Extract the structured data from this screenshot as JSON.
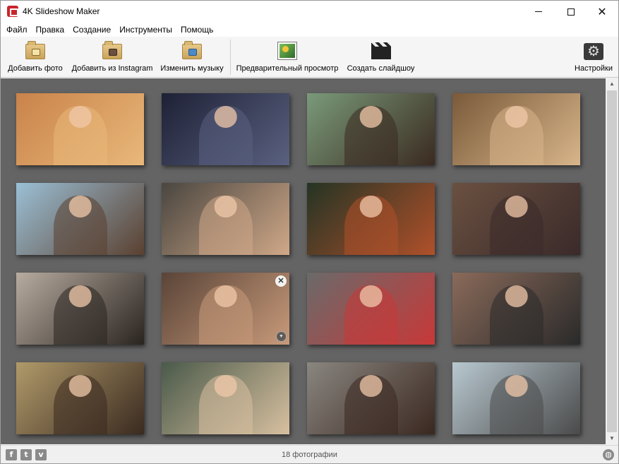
{
  "window": {
    "title": "4K Slideshow Maker"
  },
  "menu": [
    "Файл",
    "Правка",
    "Создание",
    "Инструменты",
    "Помощь"
  ],
  "toolbar": {
    "add_photo": "Добавить фото",
    "add_instagram": "Добавить из Instagram",
    "change_music": "Изменить музыку",
    "preview": "Предварительный просмотр",
    "create_slideshow": "Создать слайдшоу",
    "settings": "Настройки"
  },
  "photos": [
    {
      "bg": "#c9834a",
      "accent": "#e9b87a"
    },
    {
      "bg": "#1e2135",
      "accent": "#5a6080"
    },
    {
      "bg": "#7a9a7a",
      "accent": "#3a2a20"
    },
    {
      "bg": "#7a5a3a",
      "accent": "#d8b58a"
    },
    {
      "bg": "#9bc0d6",
      "accent": "#5a4030"
    },
    {
      "bg": "#4a4640",
      "accent": "#d0a888"
    },
    {
      "bg": "#243424",
      "accent": "#b0502a"
    },
    {
      "bg": "#6a5040",
      "accent": "#3a2a2a"
    },
    {
      "bg": "#b8aca0",
      "accent": "#2a2420"
    },
    {
      "bg": "#5a4438",
      "accent": "#c89a7a"
    },
    {
      "bg": "#6a6a6a",
      "accent": "#c83838"
    },
    {
      "bg": "#8a6a5a",
      "accent": "#2a2a2a"
    },
    {
      "bg": "#b09a6a",
      "accent": "#3a2a20"
    },
    {
      "bg": "#4a5a4a",
      "accent": "#d8c0a0"
    },
    {
      "bg": "#8a8680",
      "accent": "#3a2820"
    },
    {
      "bg": "#b8c8d0",
      "accent": "#4a4a4a"
    }
  ],
  "status": {
    "count": "18 фотографии"
  },
  "social": {
    "facebook": "f",
    "twitter": "t",
    "vimeo": "v"
  }
}
